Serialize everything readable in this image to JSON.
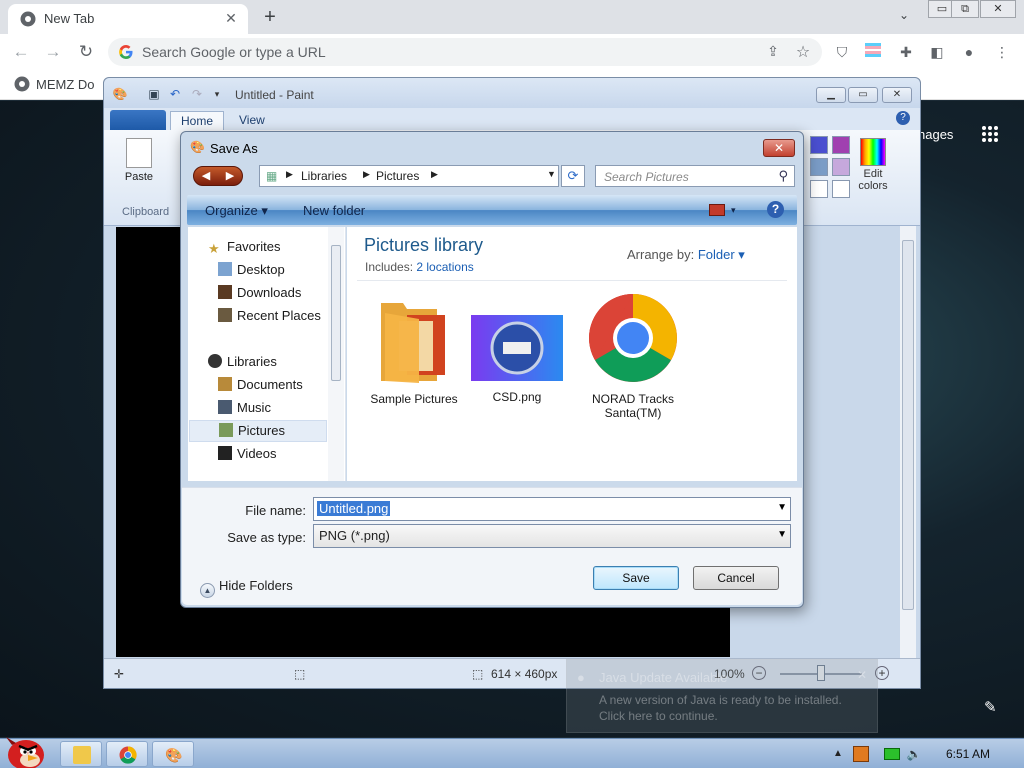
{
  "browser": {
    "tab_title": "New Tab",
    "tab_close": "✕",
    "new_tab": "+",
    "omnibox_placeholder": "Search Google or type a URL",
    "bookmark_label": "MEMZ Do",
    "ntp_images": "nages",
    "window_controls": [
      "▭",
      "⧉",
      "✕"
    ]
  },
  "paint": {
    "title": "Untitled - Paint",
    "tabs": [
      "Home",
      "View"
    ],
    "paste_label": "Paste",
    "clipboard_group": "Clipboard",
    "edit_colors": [
      "Edit",
      "colors"
    ],
    "swatch_colors": [
      "#4a4fd0",
      "#a040b0",
      "#7a9cc6",
      "#c6a8dc",
      "#ffffff",
      "#ffffff"
    ],
    "status_dimensions": "614 × 460px",
    "zoom": "100%",
    "zoom_minus": "−",
    "zoom_plus": "+"
  },
  "dialog": {
    "title": "Save As",
    "close": "✕",
    "breadcrumbs": [
      "Libraries",
      "Pictures"
    ],
    "search_placeholder": "Search Pictures",
    "commands": {
      "organize": "Organize ▾",
      "new_folder": "New folder",
      "help": "?"
    },
    "nav": {
      "favorites_header": "Favorites",
      "favorites": [
        "Desktop",
        "Downloads",
        "Recent Places"
      ],
      "libraries_header": "Libraries",
      "libraries": [
        "Documents",
        "Music",
        "Pictures",
        "Videos"
      ]
    },
    "library_title": "Pictures library",
    "includes_label": "Includes:",
    "includes_link": "2 locations",
    "arrange_label": "Arrange by:",
    "arrange_value": "Folder ▾",
    "files": [
      {
        "name": "Sample Pictures",
        "kind": "folder"
      },
      {
        "name": "CSD.png",
        "kind": "image"
      },
      {
        "name": "NORAD Tracks Santa(TM)",
        "kind": "chrome-shortcut"
      }
    ],
    "file_name_label": "File name:",
    "file_name_value": "Untitled.png",
    "save_type_label": "Save as type:",
    "save_type_value": "PNG (*.png)",
    "hide_folders": "Hide Folders",
    "save_button": "Save",
    "cancel_button": "Cancel"
  },
  "notification": {
    "title": "Java Update Available",
    "body_line1": "A new version of Java is ready to be installed.",
    "body_line2": "Click here to continue."
  },
  "taskbar": {
    "clock": "6:51 AM"
  }
}
